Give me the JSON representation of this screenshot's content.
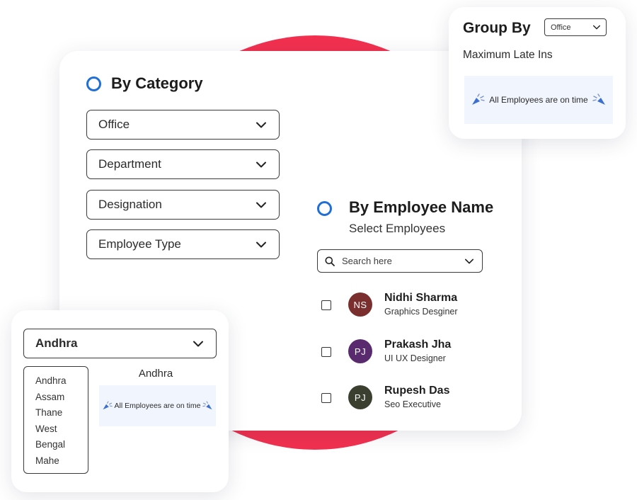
{
  "by_category": {
    "heading": "By Category",
    "filters": [
      {
        "label": "Office"
      },
      {
        "label": "Department"
      },
      {
        "label": "Designation"
      },
      {
        "label": "Employee Type"
      }
    ]
  },
  "by_employee": {
    "heading": "By Employee Name",
    "subheading": "Select Employees",
    "search_placeholder": "Search here",
    "employees": [
      {
        "initials": "NS",
        "name": "Nidhi Sharma",
        "role": "Graphics Desginer",
        "avatar_color": "#7a2e2e"
      },
      {
        "initials": "PJ",
        "name": "Prakash Jha",
        "role": "UI UX Designer",
        "avatar_color": "#5a2a6e"
      },
      {
        "initials": "PJ",
        "name": "Rupesh Das",
        "role": "Seo Executive",
        "avatar_color": "#3a3f2f"
      }
    ]
  },
  "group_by": {
    "title": "Group By",
    "select_value": "Office",
    "subtitle": "Maximum Late Ins",
    "notice": "All Employees are on time"
  },
  "location": {
    "selected": "Andhra",
    "options": [
      "Andhra",
      "Assam",
      "Thane",
      "West",
      "Bengal",
      "Mahe"
    ],
    "panel_title": "Andhra",
    "notice": "All Employees are on time"
  },
  "colors": {
    "accent": "#1f6fd6",
    "blob": "#f2304f",
    "notice_bg": "#f1f5fd"
  },
  "icons": {
    "celebration": "party-popper-icon",
    "search": "search-icon",
    "dropdown": "chevron-down-icon"
  }
}
